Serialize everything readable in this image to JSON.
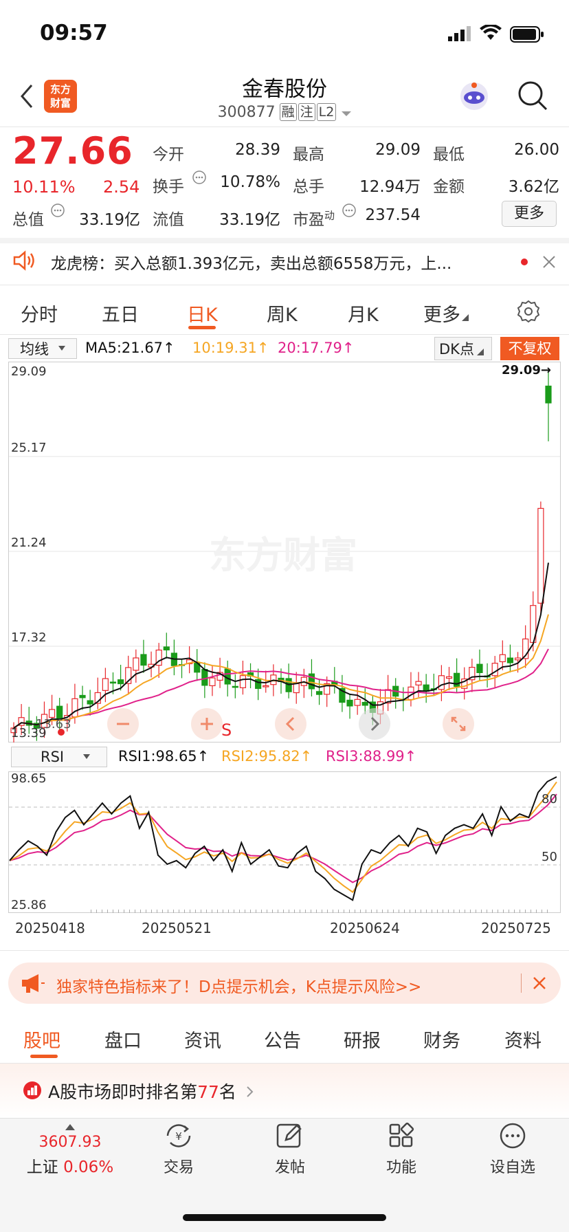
{
  "status_bar": {
    "time": "09:57"
  },
  "header": {
    "name": "金春股份",
    "code": "300877",
    "tags": [
      "融",
      "注",
      "L2"
    ],
    "logo_text": "东方\n财富"
  },
  "quote": {
    "price": "27.66",
    "change_pct": "10.11%",
    "change": "2.54",
    "fields": [
      {
        "label": "今开",
        "value": "28.39",
        "red": true
      },
      {
        "label": "最高",
        "value": "29.09",
        "red": true
      },
      {
        "label": "最低",
        "value": "26.00",
        "red": true
      },
      {
        "label": "换手",
        "value": "10.78%",
        "red": false
      },
      {
        "label": "总手",
        "value": "12.94万",
        "red": false
      },
      {
        "label": "金额",
        "value": "3.62亿",
        "red": false
      },
      {
        "label": "总值",
        "value": "33.19亿",
        "red": false
      },
      {
        "label": "流值",
        "value": "33.19亿",
        "red": false
      },
      {
        "label": "市盈",
        "value": "237.54",
        "red": false
      }
    ],
    "pe_super": "动",
    "more_label": "更多"
  },
  "notice": {
    "text": "龙虎榜：买入总额1.393亿元，卖出总额6558万元，上..."
  },
  "chart_tabs": [
    "分时",
    "五日",
    "日K",
    "周K",
    "月K",
    "更多"
  ],
  "chart_tabs_active": "日K",
  "ma_legend": {
    "selector": "均线",
    "ma5": "MA5:21.67↑",
    "ma10": "10:19.31↑",
    "ma20": "20:17.79↑",
    "dk_label": "DK点",
    "fq_label": "不复权"
  },
  "kline": {
    "y_labels": [
      "29.09",
      "25.17",
      "21.24",
      "17.32",
      "13.39"
    ],
    "high_mark": "29.09→",
    "low_mark": "13.63",
    "watermark": "东方财富",
    "s_mark": "S"
  },
  "rsi_legend": {
    "selector": "RSI",
    "rsi1": "RSI1:98.65↑",
    "rsi2": "RSI2:95.82↑",
    "rsi3": "RSI3:88.99↑"
  },
  "rsi": {
    "y_top": "98.65",
    "y_bottom": "25.86",
    "ref80": "80",
    "ref50": "50"
  },
  "dates": [
    "20250418",
    "20250521",
    "20250624",
    "20250725"
  ],
  "banner": {
    "text": "独家特色指标来了！D点提示机会，K点提示风险>>"
  },
  "bottom_tabs": [
    "股吧",
    "盘口",
    "资讯",
    "公告",
    "研报",
    "财务",
    "资料"
  ],
  "bottom_tabs_active": "股吧",
  "rank": {
    "prefix": "A股市场即时排名第",
    "num": "77",
    "suffix": "名"
  },
  "nav": {
    "index_value": "3607.93",
    "index_name": "上证",
    "index_pct": "0.06%",
    "items": [
      "交易",
      "发帖",
      "功能",
      "设自选"
    ]
  },
  "colors": {
    "up": "#e8262b",
    "down": "#1a9b1a",
    "ma5": "#111111",
    "ma10": "#f5a623",
    "ma20": "#e0218a",
    "accent": "#f05a22"
  },
  "chart_data": [
    {
      "type": "candlestick",
      "x_ticks": [
        "20250418",
        "20250521",
        "20250624",
        "20250725"
      ],
      "ylim": [
        13.39,
        29.09
      ],
      "series_labels": [
        "MA5:21.67",
        "10:19.31",
        "20:17.79"
      ],
      "latest": {
        "open": 28.39,
        "high": 29.09,
        "low": 26.0,
        "close": 27.66
      }
    },
    {
      "type": "line",
      "ylim": [
        25.86,
        98.65
      ],
      "reference_lines": [
        80,
        50
      ],
      "series": [
        {
          "name": "RSI1",
          "last": 98.65
        },
        {
          "name": "RSI2",
          "last": 95.82
        },
        {
          "name": "RSI3",
          "last": 88.99
        }
      ]
    }
  ]
}
